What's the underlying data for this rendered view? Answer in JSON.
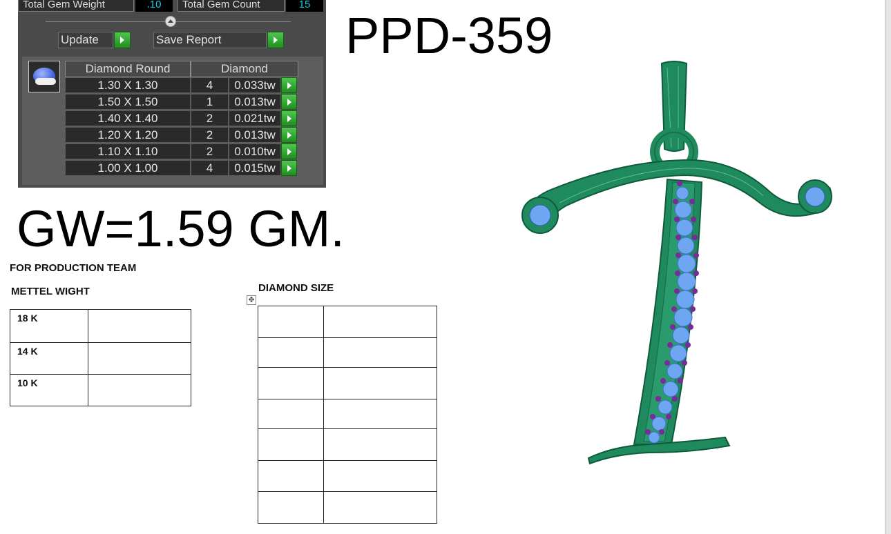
{
  "cad_panel": {
    "total_gem_weight": {
      "label": "Total Gem Weight",
      "value": ".10"
    },
    "total_gem_count": {
      "label": "Total Gem Count",
      "value": "15"
    },
    "buttons": {
      "update": "Update",
      "save_report": "Save Report"
    },
    "gem_table": {
      "headers": [
        "Diamond Round",
        "Diamond"
      ],
      "rows": [
        {
          "size": "1.30 X 1.30",
          "qty": "4",
          "weight": "0.033tw"
        },
        {
          "size": "1.50 X 1.50",
          "qty": "1",
          "weight": "0.013tw"
        },
        {
          "size": "1.40 X 1.40",
          "qty": "2",
          "weight": "0.021tw"
        },
        {
          "size": "1.20 X 1.20",
          "qty": "2",
          "weight": "0.013tw"
        },
        {
          "size": "1.10 X 1.10",
          "qty": "2",
          "weight": "0.010tw"
        },
        {
          "size": "1.00 X 1.00",
          "qty": "4",
          "weight": "0.015tw"
        }
      ]
    }
  },
  "document": {
    "design_code": "PPD-359",
    "gross_weight": "GW=1.59 GM.",
    "production_heading": "FOR PRODUCTION TEAM",
    "metal_weight_heading": "METTEL WIGHT",
    "metal_rows": [
      "18 K",
      "14 K",
      "10 K"
    ],
    "diamond_size_heading": "DIAMOND SIZE"
  },
  "colors": {
    "metal_green": "#1e8a5e",
    "stone_blue": "#6fa6f2",
    "accent_purple": "#7a2a9a",
    "value_cyan": "#16d0e6"
  },
  "icons": {
    "gem_preview": "blue-gem-icon",
    "go_buttons": "green-arrow-icon",
    "divider_knob": "chevron-up-icon",
    "table_handle": "move-icon"
  }
}
